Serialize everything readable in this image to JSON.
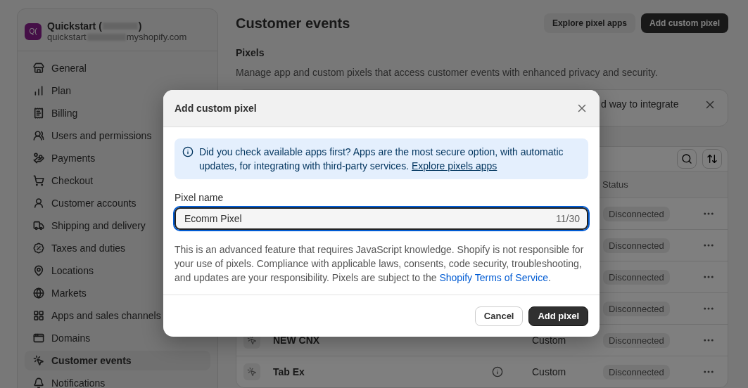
{
  "store": {
    "avatar": "Q(",
    "name_start": "Quickstart (",
    "name_end": ")",
    "domain_start": "quickstart",
    "domain_end": "myshopify.com"
  },
  "sidebar": {
    "items": [
      {
        "label": "General",
        "selected": false
      },
      {
        "label": "Plan",
        "selected": false
      },
      {
        "label": "Billing",
        "selected": false
      },
      {
        "label": "Users and permissions",
        "selected": false
      },
      {
        "label": "Payments",
        "selected": false
      },
      {
        "label": "Checkout",
        "selected": false
      },
      {
        "label": "Customer accounts",
        "selected": false
      },
      {
        "label": "Shipping and delivery",
        "selected": false
      },
      {
        "label": "Taxes and duties",
        "selected": false
      },
      {
        "label": "Locations",
        "selected": false
      },
      {
        "label": "Markets",
        "selected": false
      },
      {
        "label": "Apps and sales channels",
        "selected": false
      },
      {
        "label": "Domains",
        "selected": false
      },
      {
        "label": "Customer events",
        "selected": true
      },
      {
        "label": "Notifications",
        "selected": false
      }
    ]
  },
  "page": {
    "title": "Customer events",
    "buttons": [
      "Explore pixel apps",
      "Add custom pixel"
    ],
    "section_title": "Pixels",
    "section_description": "Manage app and custom pixels that access customer events with enhanced privacy and security.",
    "banner_text": "d way to integrate"
  },
  "table": {
    "columns": [
      "Status"
    ],
    "rows": [
      {
        "status": "Disconnected"
      },
      {
        "status": "Disconnected"
      },
      {
        "status": "Disconnected"
      },
      {
        "status": "Disconnected"
      },
      {
        "name": "NEW CNX",
        "info": false,
        "type": "Custom",
        "status": "Disconnected"
      },
      {
        "name": "Tab Ex",
        "info": true,
        "type": "Custom",
        "status": "Disconnected"
      }
    ]
  },
  "modal": {
    "title": "Add custom pixel",
    "notice": "Did you check available apps first? Apps are the most secure option, with automatic updates, for integrating with third-party services.",
    "notice_link": "Explore pixels apps",
    "field_label": "Pixel name",
    "field_value": "Ecomm Pixel",
    "counter": "11/30",
    "disclaimer": "This is an advanced feature that requires JavaScript knowledge. Shopify is not responsible for your use of pixels. Compliance with applicable laws, consents, code security, troubleshooting, and updates are your responsibility. Pixels are subject to the",
    "disclaimer_link": "Shopify Terms of Service",
    "disclaimer_end": ".",
    "cancel": "Cancel",
    "confirm": "Add pixel"
  }
}
